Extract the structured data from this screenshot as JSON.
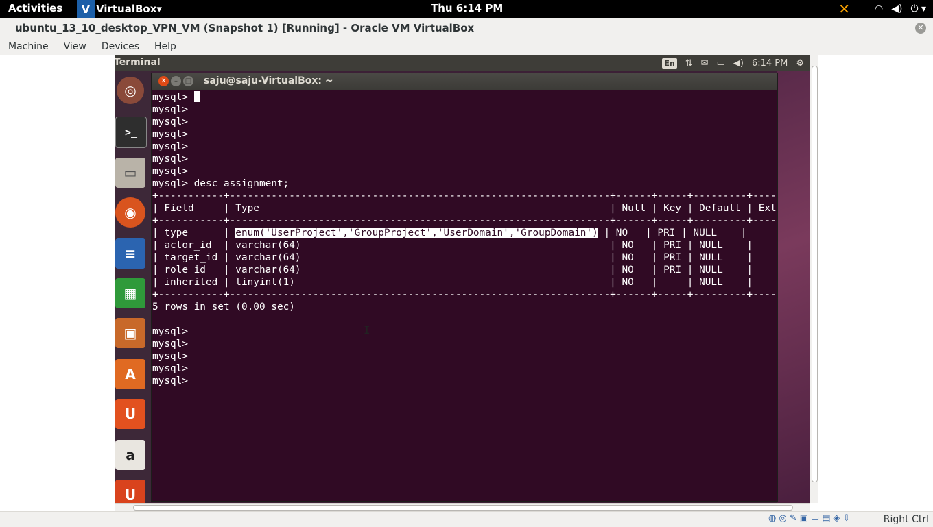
{
  "host_topbar": {
    "activities": "Activities",
    "app_menu": "VirtualBox",
    "app_menu_caret": "▾",
    "clock": "Thu  6:14 PM",
    "tray_icons": [
      "x-icon",
      "wifi-icon",
      "volume-icon",
      "power-icon"
    ]
  },
  "window": {
    "title": "ubuntu_13_10_desktop_VPN_VM (Snapshot 1) [Running] - Oracle VM VirtualBox"
  },
  "menubar": {
    "items": [
      "Machine",
      "View",
      "Devices",
      "Help"
    ]
  },
  "guest_panel": {
    "app_title": "Terminal",
    "keyboard_layout": "En",
    "time": "6:14 PM"
  },
  "launcher": {
    "items": [
      "ubuntu-dash-icon",
      "terminal-icon",
      "files-icon",
      "firefox-icon",
      "writer-icon",
      "calc-icon",
      "impress-icon",
      "software-center-icon",
      "ubuntu-one-icon",
      "amazon-icon",
      "ubuntu-icon"
    ]
  },
  "terminal": {
    "title": "saju@saju-VirtualBox: ~",
    "lines_top": "mysql> ",
    "lines_prompts": "mysql>\nmysql>\nmysql>\nmysql>\nmysql>\nmysql>",
    "command": "mysql> desc assignment;",
    "table_head": "+-----------+----------------------------------------------------------------+------+-----+---------+-------+\n| Field     | Type                                                           | Null | Key | Default | Extra |\n+-----------+----------------------------------------------------------------+------+-----+---------+-------+",
    "row1_pre": "| type      | ",
    "row1_selected": "enum('UserProject','GroupProject','UserDomain','GroupDomain')",
    "row1_post": " | NO   | PRI | NULL    |       |",
    "table_rest": "| actor_id  | varchar(64)                                                    | NO   | PRI | NULL    |       |\n| target_id | varchar(64)                                                    | NO   | PRI | NULL    |       |\n| role_id   | varchar(64)                                                    | NO   | PRI | NULL    |       |\n| inherited | tinyint(1)                                                     | NO   |     | NULL    |       |\n+-----------+----------------------------------------------------------------+------+-----+---------+-------+",
    "result": "5 rows in set (0.00 sec)",
    "lines_bottom": "\nmysql>\nmysql>\nmysql>\nmysql>\nmysql>"
  },
  "statusbar": {
    "icons": [
      "hdd-icon",
      "cd-icon",
      "usb-icon",
      "network-icon",
      "shared-folder-icon",
      "display-icon",
      "mouse-icon",
      "keyboard-icon"
    ],
    "host_key": "Right Ctrl"
  }
}
